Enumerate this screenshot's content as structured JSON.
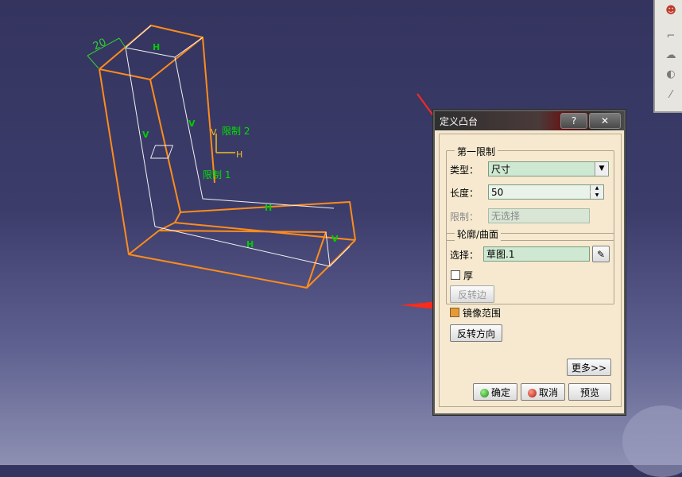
{
  "viewport": {
    "dimension_label": "20",
    "limit2_label": "限制 2",
    "limit1_label": "限制 1",
    "axis_h": "H",
    "axis_v": "V"
  },
  "dialog": {
    "title": "定义凸台",
    "help_button": "?",
    "close_button": "✕",
    "first_limit": {
      "legend": "第一限制",
      "type_label": "类型：",
      "type_value": "尺寸",
      "length_label": "长度：",
      "length_value": "50",
      "limit_label": "限制：",
      "limit_value": "无选择"
    },
    "profile": {
      "legend": "轮廓/曲面",
      "select_label": "选择：",
      "select_value": "草图.1",
      "thick_label": "厚",
      "thick_checked": false,
      "reverse_side_label": "反转边"
    },
    "mirror_label": "镜像范围",
    "mirror_checked": true,
    "reverse_dir_label": "反转方向",
    "more_label": "更多>>",
    "ok_label": "确定",
    "cancel_label": "取消",
    "preview_label": "预览"
  },
  "colors": {
    "accent_orange": "#ff8c1a",
    "label_green": "#00e000",
    "arrow_red": "#ff2a1a",
    "field_green": "#cfe8d2"
  }
}
